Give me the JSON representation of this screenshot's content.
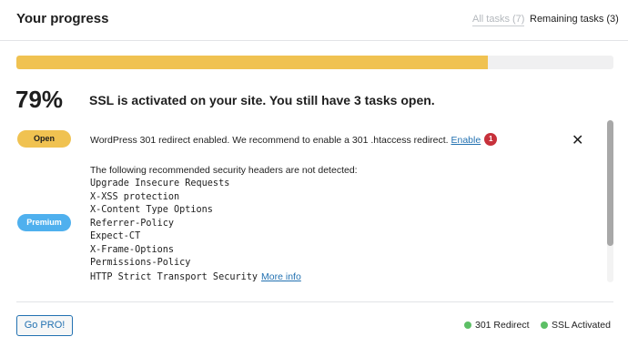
{
  "header": {
    "title": "Your progress",
    "filter_all": "All tasks (7)",
    "filter_remaining": "Remaining tasks (3)"
  },
  "progress": {
    "percent_value": 79,
    "percent_label": "79%",
    "message": "SSL is activated on your site. You still have 3 tasks open."
  },
  "tasks": {
    "task1": {
      "badge": "Open",
      "text": "WordPress 301 redirect enabled. We recommend to enable a 301 .htaccess redirect.",
      "link": "Enable",
      "notification_count": "1"
    },
    "task2": {
      "badge": "Premium",
      "intro": "The following recommended security headers are not detected:",
      "headers": [
        "Upgrade Insecure Requests",
        "X-XSS protection",
        "X-Content Type Options",
        "Referrer-Policy",
        "Expect-CT",
        "X-Frame-Options",
        "Permissions-Policy",
        "HTTP Strict Transport Security"
      ],
      "link": "More info"
    }
  },
  "footer": {
    "button": "Go PRO!",
    "status_items": [
      "301 Redirect",
      "SSL Activated"
    ]
  },
  "colors": {
    "progress_fill": "#f0c251",
    "open_badge": "#f0c251",
    "premium_badge": "#4fb0ee",
    "status_dot": "#5cbf65",
    "link": "#2271b1",
    "notification": "#c7313b"
  },
  "icons": {
    "close": "close-icon",
    "status": "status-dot-icon"
  }
}
